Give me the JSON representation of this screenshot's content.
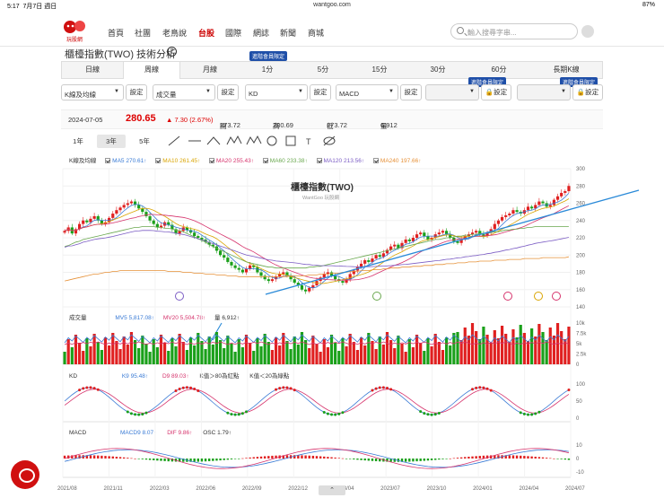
{
  "status": {
    "time": "5:17",
    "date": "7月7日 週日",
    "url": "wantgoo.com",
    "battery": "87%"
  },
  "nav": {
    "brand": "玩股網",
    "items": [
      "首頁",
      "社團",
      "老鳥說",
      "台股",
      "國際",
      "網誌",
      "新聞",
      "商城"
    ],
    "active": "台股",
    "search_placeholder": "輸入搜尋字串..."
  },
  "page": {
    "title": "櫃檯指數(TWO) 技術分析"
  },
  "tabs": [
    "日線",
    "周線",
    "月線",
    "1分",
    "5分",
    "15分",
    "30分",
    "60分",
    "長期K線"
  ],
  "active_tab": "周線",
  "vip_label": "進階會員限定",
  "selectors": [
    {
      "value": "K線及均線",
      "button": "設定"
    },
    {
      "value": "成交量",
      "button": "設定"
    },
    {
      "value": "KD",
      "button": "設定"
    },
    {
      "value": "MACD",
      "button": "設定"
    },
    {
      "value": "",
      "button": "設定",
      "locked": true
    },
    {
      "value": "",
      "button": "設定",
      "locked": true
    }
  ],
  "quote": {
    "date": "2024-07-05",
    "price": "280.65",
    "change": "▲ 7.30 (2.67%)",
    "open_label": "開",
    "open": "273.72",
    "high_label": "高",
    "high": "280.69",
    "low_label": "低",
    "low": "273.72",
    "vol_label": "量",
    "vol": "6,912"
  },
  "ranges": [
    "1年",
    "3年",
    "5年"
  ],
  "active_range": "3年",
  "tools": [
    "line-icon",
    "hline-icon",
    "angle-icon",
    "wave-icon",
    "wave2-icon",
    "circle-icon",
    "rect-icon",
    "text-icon",
    "hide-icon"
  ],
  "main_legend": {
    "title": "K線及均線",
    "mas": [
      {
        "label": "MA5",
        "value": "270.61↑",
        "color": "#3a7bd5"
      },
      {
        "label": "MA10",
        "value": "261.45↑",
        "color": "#d9a400"
      },
      {
        "label": "MA20",
        "value": "255.43↑",
        "color": "#d6336c"
      },
      {
        "label": "MA60",
        "value": "233.38↑",
        "color": "#6aa84f"
      },
      {
        "label": "MA120",
        "value": "213.56↑",
        "color": "#7b5cc4"
      },
      {
        "label": "MA240",
        "value": "197.66↑",
        "color": "#e69138"
      }
    ]
  },
  "watermark": {
    "title": "櫃檯指數(TWO)",
    "sub": "WantGoo 玩股網"
  },
  "vol_legend": {
    "title": "成交量",
    "mv5": "MV5 5,817.08↑",
    "mv20": "MV20 5,504.78↑",
    "vol": "量 6,912↑"
  },
  "kd_legend": {
    "title": "KD",
    "k9": "K9 95.48↑",
    "d9": "D9 89.03↑",
    "note1": "K值＞80為紅點",
    "note2": "K值＜20為綠點"
  },
  "macd_legend": {
    "title": "MACD",
    "macd9": "MACD9 8.07↑",
    "dif": "DIF 9.86↑",
    "osc": "OSC 1.79↑"
  },
  "chart_data": {
    "type": "candlestick",
    "price_ylim": [
      140,
      300
    ],
    "price_ticks": [
      "300",
      "280",
      "260",
      "240",
      "220",
      "200",
      "180",
      "160",
      "140"
    ],
    "vol_ticks": [
      "10k",
      "7.5k",
      "5k",
      "2.5k",
      "0"
    ],
    "kd_ticks": [
      "100",
      "50",
      "0"
    ],
    "macd_ticks": [
      "10",
      "0",
      "-10"
    ],
    "x_ticks": [
      "2021/08",
      "2021/11",
      "2022/03",
      "2022/06",
      "2022/09",
      "2022/12",
      "2023/04",
      "2023/07",
      "2023/10",
      "2024/01",
      "2024/04",
      "2024/07"
    ],
    "close": [
      228,
      232,
      225,
      230,
      236,
      240,
      238,
      242,
      245,
      240,
      236,
      238,
      243,
      248,
      252,
      255,
      258,
      260,
      262,
      258,
      254,
      250,
      245,
      240,
      236,
      232,
      234,
      238,
      235,
      230,
      225,
      228,
      232,
      229,
      226,
      222,
      220,
      218,
      215,
      212,
      210,
      205,
      200,
      197,
      192,
      188,
      185,
      183,
      180,
      184,
      188,
      186,
      180,
      176,
      172,
      170,
      172,
      175,
      178,
      180,
      176,
      172,
      168,
      165,
      160,
      158,
      162,
      165,
      170,
      174,
      178,
      180,
      176,
      172,
      170,
      168,
      172,
      178,
      182,
      186,
      190,
      194,
      192,
      196,
      200,
      198,
      202,
      206,
      210,
      212,
      208,
      214,
      218,
      216,
      220,
      224,
      226,
      222,
      218,
      220,
      224,
      226,
      228,
      224,
      220,
      216,
      214,
      218,
      222,
      224,
      226,
      228,
      224,
      222,
      226,
      230,
      236,
      240,
      244,
      246,
      248,
      252,
      250,
      248,
      252,
      256,
      254,
      258,
      262,
      260,
      256,
      258,
      264,
      268,
      272,
      274,
      280
    ],
    "ma60": [
      210,
      211,
      213,
      215,
      216,
      218,
      219,
      220,
      221,
      222,
      223,
      224,
      225,
      226,
      227,
      228,
      229,
      230,
      231,
      232,
      232,
      233,
      233,
      233,
      233,
      232,
      232,
      231,
      231,
      230,
      229,
      228,
      227,
      225,
      223,
      221,
      219,
      217,
      215,
      212,
      210,
      208,
      206,
      204,
      202,
      200,
      198,
      196,
      194,
      192,
      191,
      190,
      189,
      188,
      187,
      186,
      186,
      185,
      185,
      185,
      185,
      185,
      185,
      185,
      185,
      185,
      186,
      186,
      187,
      187,
      188,
      189,
      190,
      191,
      192,
      193,
      194,
      195,
      196,
      197,
      198,
      199,
      200,
      201,
      202,
      203,
      204,
      205,
      206,
      207,
      208,
      209,
      210,
      211,
      212,
      213,
      214,
      215,
      216,
      217,
      218,
      218,
      219,
      220,
      220,
      221,
      222,
      222,
      223,
      223,
      224,
      224,
      225,
      225,
      226,
      226,
      227,
      227,
      228,
      229,
      229,
      230,
      230,
      231,
      231,
      232,
      232,
      233,
      233,
      233,
      233,
      233,
      233,
      233,
      233,
      233,
      233
    ],
    "ma240": [
      170,
      171,
      172,
      173,
      174,
      175,
      176,
      177,
      178,
      178,
      179,
      180,
      180,
      181,
      181,
      182,
      182,
      182,
      182,
      182,
      182,
      182,
      182,
      182,
      182,
      182,
      182,
      182,
      181,
      181,
      181,
      181,
      180,
      180,
      180,
      179,
      179,
      179,
      178,
      178,
      178,
      177,
      177,
      177,
      176,
      176,
      176,
      175,
      175,
      175,
      175,
      175,
      175,
      175,
      175,
      175,
      175,
      175,
      175,
      175,
      175,
      176,
      176,
      176,
      176,
      176,
      177,
      177,
      177,
      178,
      178,
      178,
      179,
      179,
      179,
      180,
      180,
      181,
      181,
      181,
      182,
      182,
      182,
      183,
      183,
      183,
      184,
      184,
      185,
      185,
      185,
      186,
      186,
      186,
      187,
      187,
      187,
      188,
      188,
      188,
      189,
      189,
      189,
      190,
      190,
      190,
      191,
      191,
      191,
      192,
      192,
      192,
      193,
      193,
      193,
      193,
      194,
      194,
      194,
      194,
      195,
      195,
      195,
      195,
      196,
      196,
      196,
      196,
      196,
      197,
      197,
      197,
      197,
      197,
      197,
      197,
      198
    ]
  }
}
